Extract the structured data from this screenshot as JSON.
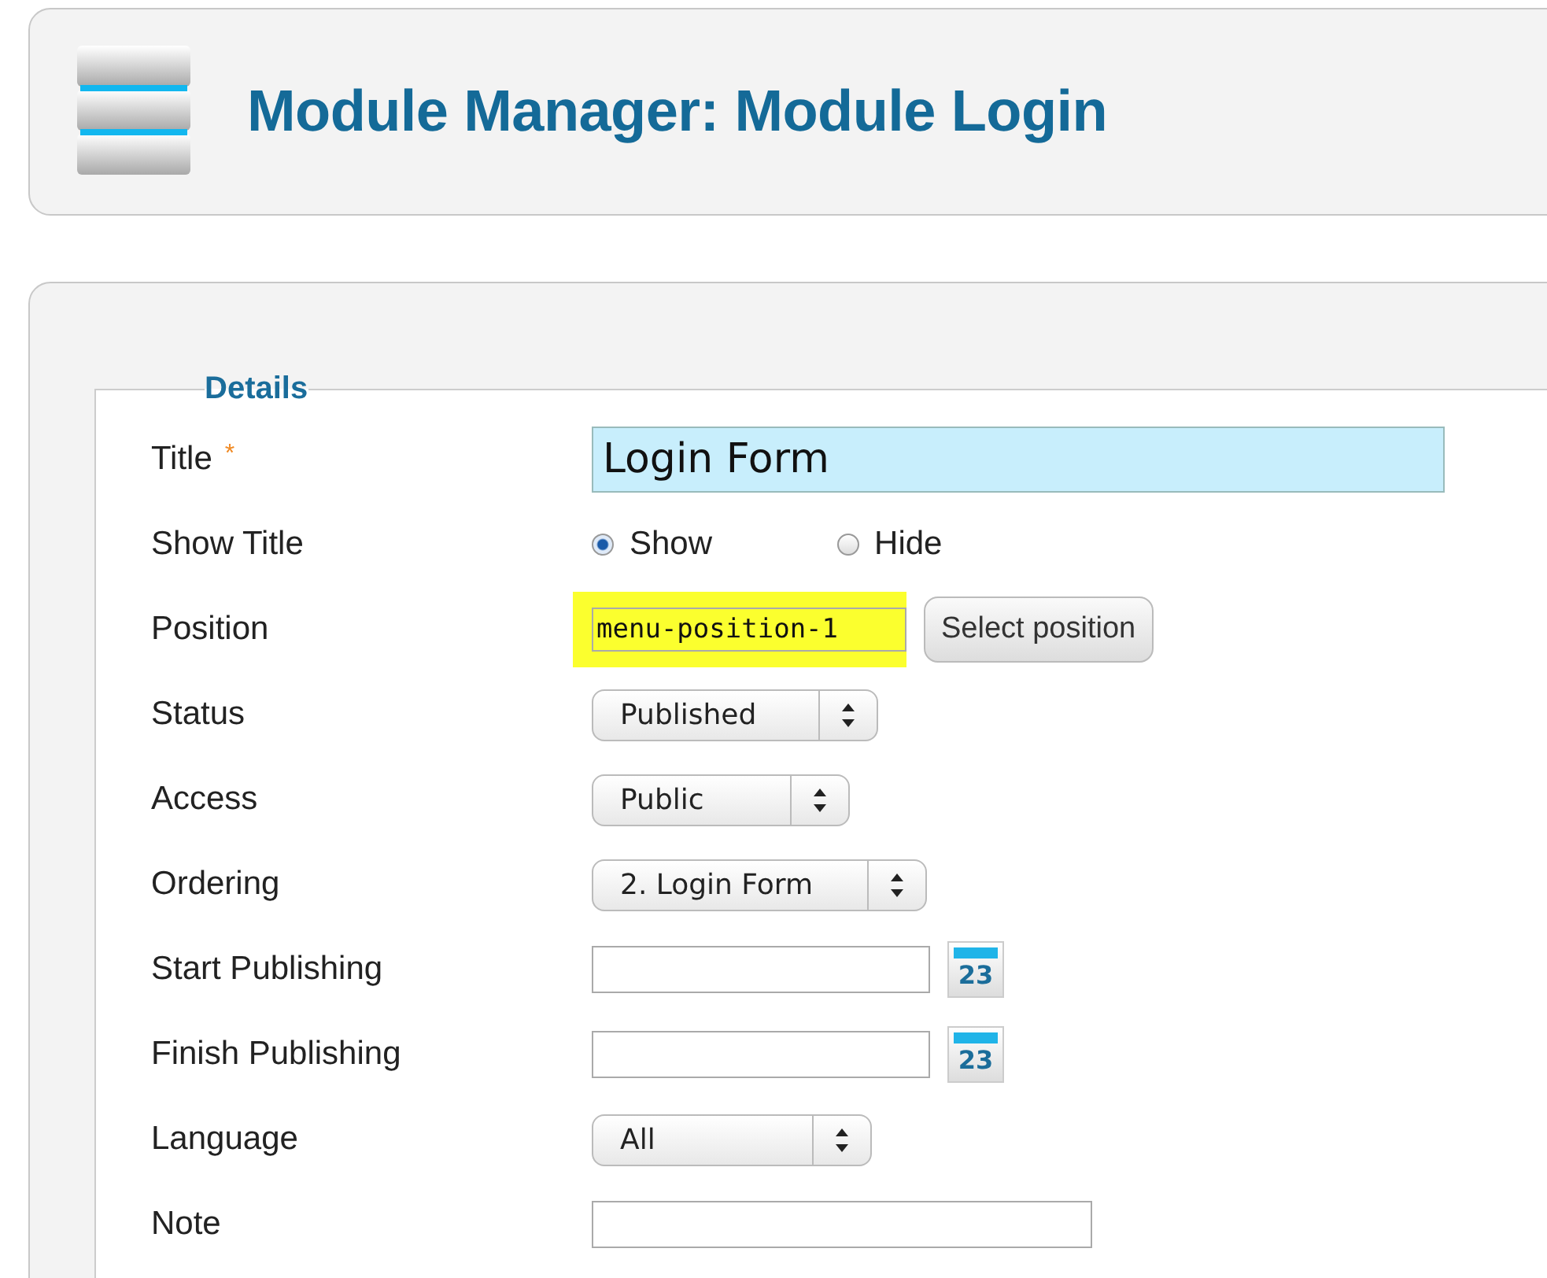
{
  "header": {
    "title": "Module Manager: Module Login"
  },
  "details": {
    "legend": "Details",
    "rows": [
      {
        "kind": "text",
        "label": "Title",
        "required_mark": "*",
        "value": "Login Form",
        "focused": true
      },
      {
        "kind": "radio",
        "label": "Show Title",
        "options": [
          {
            "label": "Show",
            "selected": true
          },
          {
            "label": "Hide",
            "selected": false
          }
        ]
      },
      {
        "kind": "position",
        "label": "Position",
        "value": "menu-position-1",
        "highlighted": true,
        "button": "Select position"
      },
      {
        "kind": "select",
        "label": "Status",
        "value": "Published"
      },
      {
        "kind": "select",
        "label": "Access",
        "value": "Public"
      },
      {
        "kind": "select",
        "label": "Ordering",
        "value": "2. Login Form"
      },
      {
        "kind": "date",
        "label": "Start Publishing",
        "calendar_day": "23"
      },
      {
        "kind": "date",
        "label": "Finish Publishing",
        "calendar_day": "23"
      },
      {
        "kind": "select",
        "label": "Language",
        "value": "All"
      },
      {
        "kind": "text",
        "label": "Note",
        "focused": false
      }
    ]
  }
}
